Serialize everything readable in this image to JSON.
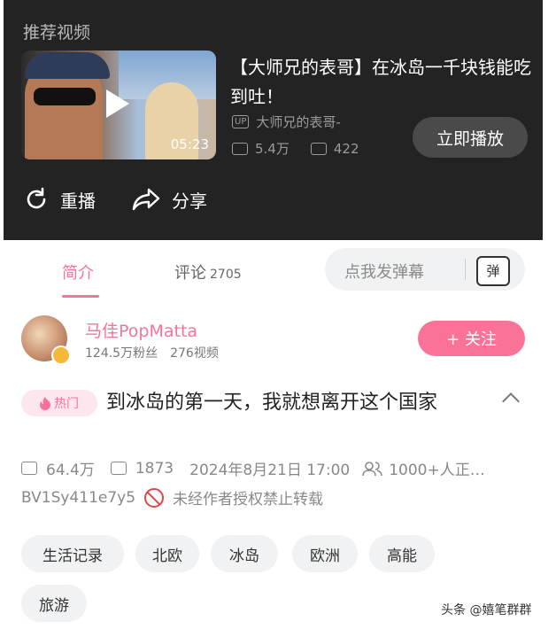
{
  "player": {
    "recommend_label": "推荐视频",
    "rec_video": {
      "title": "【大师兄的表哥】在冰岛一千块钱能吃到吐！",
      "up_badge": "UP",
      "uploader": "大师兄的表哥-",
      "duration": "05:23",
      "views": "5.4万",
      "danmaku": "422"
    },
    "play_now_label": "立即播放",
    "replay_label": "重播",
    "share_label": "分享"
  },
  "tabs": {
    "intro_label": "简介",
    "comments_label": "评论",
    "comments_count": "2705",
    "danmaku_placeholder": "点我发弹幕",
    "danmaku_button": "弹"
  },
  "author": {
    "name": "马佳PopMatta",
    "followers": "124.5万粉丝",
    "videos": "276视频",
    "follow_label": "+ 关注"
  },
  "video": {
    "hot_label": "热门",
    "title": "到冰岛的第一天，我就想离开这个国家",
    "views": "64.4万",
    "danmaku": "1873",
    "datetime": "2024年8月21日 17:00",
    "watching": "1000+人正…",
    "bvid": "BV1Sy411e7y5",
    "copyright": "未经作者授权禁止转载"
  },
  "tags": [
    "生活记录",
    "北欧",
    "冰岛",
    "欧洲",
    "高能",
    "旅游"
  ],
  "watermark": "头条 @嬉笔群群",
  "colors": {
    "accent": "#fb7299",
    "player_bg": "#232323"
  }
}
